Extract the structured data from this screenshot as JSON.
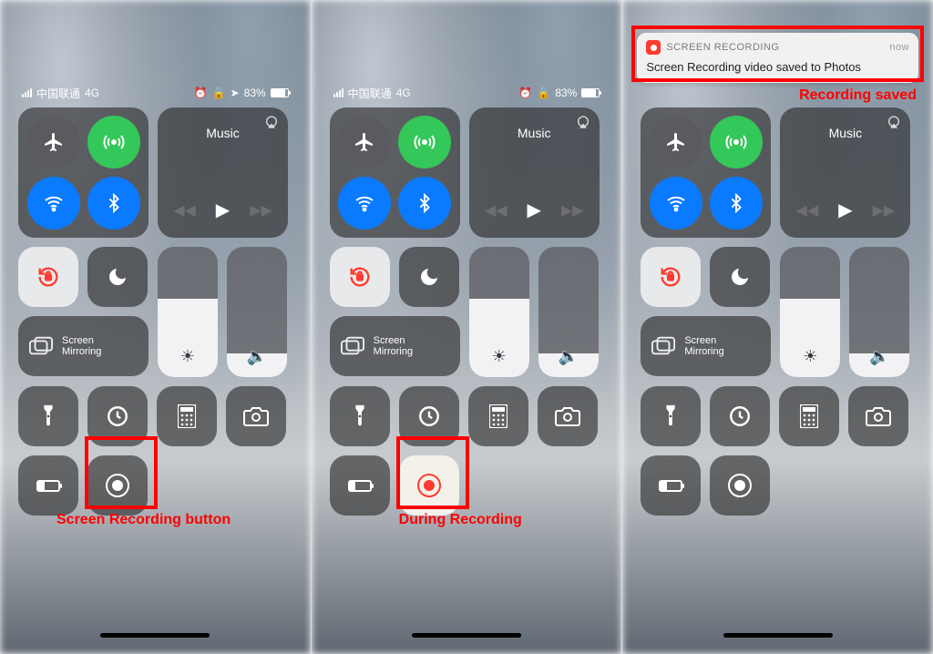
{
  "status": {
    "carrier": "中国联通",
    "network": "4G",
    "battery_pct_1": "83%",
    "battery_pct_2": "83%",
    "battery_fill": 83
  },
  "music": {
    "title": "Music"
  },
  "mirror": {
    "label_l1": "Screen",
    "label_l2": "Mirroring"
  },
  "notification": {
    "app": "SCREEN RECORDING",
    "time": "now",
    "body": "Screen Recording video saved to Photos"
  },
  "callouts": {
    "c1": "Screen Recording button",
    "c2": "During Recording",
    "c3": "Recording saved"
  },
  "icons": {
    "airplane": "airplane-icon",
    "cellular": "cellular-antenna-icon",
    "wifi": "wifi-icon",
    "bluetooth": "bluetooth-icon",
    "airplay": "airplay-icon",
    "prev": "prev-track-icon",
    "play": "play-icon",
    "next": "next-track-icon",
    "orientation": "orientation-lock-icon",
    "dnd": "moon-icon",
    "brightness": "sun-icon",
    "volume": "speaker-icon",
    "mirror": "screen-mirroring-icon",
    "flashlight": "flashlight-icon",
    "timer": "timer-icon",
    "calculator": "calculator-icon",
    "camera": "camera-icon",
    "lowpower": "low-power-icon",
    "record": "screen-recording-icon"
  }
}
